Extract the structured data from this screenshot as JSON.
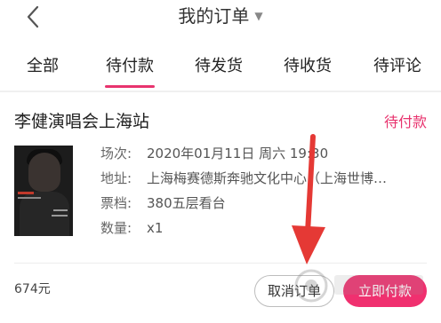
{
  "header": {
    "title": "我的订单",
    "back_icon": "chevron-left-icon",
    "caret_icon": "caret-down-icon"
  },
  "tabs": [
    {
      "label": "全部",
      "active": false
    },
    {
      "label": "待付款",
      "active": true
    },
    {
      "label": "待发货",
      "active": false
    },
    {
      "label": "待收货",
      "active": false
    },
    {
      "label": "待评论",
      "active": false
    }
  ],
  "order": {
    "title": "李健演唱会上海站",
    "status": "待付款",
    "fields": [
      {
        "key": "场次:",
        "value": "2020年01月11日 周六 19:30"
      },
      {
        "key": "地址:",
        "value": "上海梅赛德斯奔驰文化中心（上海世博…"
      },
      {
        "key": "票档:",
        "value": "380五层看台"
      },
      {
        "key": "数量:",
        "value": "x1"
      }
    ],
    "total": "674元"
  },
  "actions": {
    "cancel": "取消订单",
    "pay": "立即付款"
  },
  "colors": {
    "accent": "#e8336e",
    "pay_button": "#f0306f",
    "annotation_arrow": "#e53935"
  }
}
